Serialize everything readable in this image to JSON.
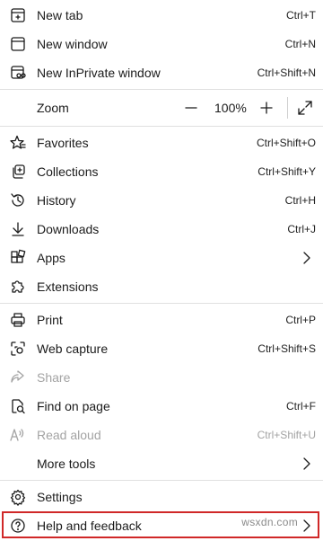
{
  "menu": {
    "items": [
      {
        "label": "New tab",
        "shortcut": "Ctrl+T"
      },
      {
        "label": "New window",
        "shortcut": "Ctrl+N"
      },
      {
        "label": "New InPrivate window",
        "shortcut": "Ctrl+Shift+N"
      },
      {
        "label": "Favorites",
        "shortcut": "Ctrl+Shift+O"
      },
      {
        "label": "Collections",
        "shortcut": "Ctrl+Shift+Y"
      },
      {
        "label": "History",
        "shortcut": "Ctrl+H"
      },
      {
        "label": "Downloads",
        "shortcut": "Ctrl+J"
      },
      {
        "label": "Apps"
      },
      {
        "label": "Extensions"
      },
      {
        "label": "Print",
        "shortcut": "Ctrl+P"
      },
      {
        "label": "Web capture",
        "shortcut": "Ctrl+Shift+S"
      },
      {
        "label": "Share"
      },
      {
        "label": "Find on page",
        "shortcut": "Ctrl+F"
      },
      {
        "label": "Read aloud",
        "shortcut": "Ctrl+Shift+U"
      },
      {
        "label": "More tools"
      },
      {
        "label": "Settings"
      },
      {
        "label": "Help and feedback"
      }
    ]
  },
  "zoom": {
    "label": "Zoom",
    "value": "100%",
    "minus": "—",
    "plus": "+"
  },
  "watermark": "wsxdn.com",
  "icons": [
    "new-tab-icon",
    "new-window-icon",
    "inprivate-icon",
    "zoom-minus-icon",
    "zoom-plus-icon",
    "fullscreen-icon",
    "favorites-icon",
    "collections-icon",
    "history-icon",
    "downloads-icon",
    "apps-icon",
    "extensions-icon",
    "print-icon",
    "web-capture-icon",
    "share-icon",
    "find-icon",
    "read-aloud-icon",
    "settings-icon",
    "help-icon",
    "chevron-right-icon"
  ],
  "colors": {
    "highlight": "#d02828",
    "disabled": "#a3a3a3",
    "separator": "#e0e0e0"
  }
}
